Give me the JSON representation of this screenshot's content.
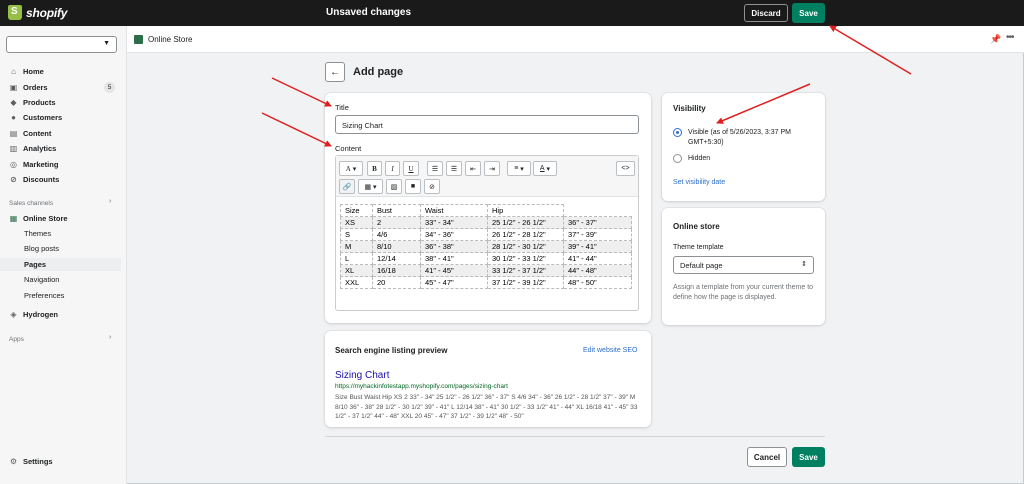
{
  "topbar": {
    "brand": "shopify",
    "status": "Unsaved changes",
    "discard_label": "Discard",
    "save_label": "Save"
  },
  "sidebar": {
    "store_selector_value": "",
    "items": [
      {
        "label": "Home",
        "icon": "home-icon"
      },
      {
        "label": "Orders",
        "icon": "orders-icon",
        "badge": "5"
      },
      {
        "label": "Products",
        "icon": "tag-icon"
      },
      {
        "label": "Customers",
        "icon": "person-icon"
      },
      {
        "label": "Content",
        "icon": "content-icon"
      },
      {
        "label": "Analytics",
        "icon": "chart-icon"
      },
      {
        "label": "Marketing",
        "icon": "target-icon"
      },
      {
        "label": "Discounts",
        "icon": "discount-icon"
      }
    ],
    "sales_channels_label": "Sales channels",
    "online_store_label": "Online Store",
    "online_store_subitems": [
      "Themes",
      "Blog posts",
      "Pages",
      "Navigation",
      "Preferences"
    ],
    "hydrogen_label": "Hydrogen",
    "apps_label": "Apps",
    "settings_label": "Settings"
  },
  "subheader": {
    "title": "Online Store"
  },
  "page": {
    "title": "Add page"
  },
  "form": {
    "title_label": "Title",
    "title_value": "Sizing Chart",
    "content_label": "Content"
  },
  "editor": {
    "toolbar_glyphs": {
      "font": "A",
      "bold": "B",
      "italic": "I",
      "underline": "U",
      "align": "≡",
      "color": "A",
      "html": "<>"
    },
    "table": {
      "header": [
        "Size",
        "Bust",
        "Waist",
        "Hip",
        ""
      ],
      "rows": [
        [
          "XS",
          "2",
          "33\" - 34\"",
          "25 1/2\" - 26 1/2\"",
          "36\" - 37\""
        ],
        [
          "S",
          "4/6",
          "34\" - 36\"",
          "26 1/2\" - 28 1/2\"",
          "37\" - 39\""
        ],
        [
          "M",
          "8/10",
          "36\" - 38\"",
          "28 1/2\" - 30 1/2\"",
          "39\" - 41\""
        ],
        [
          "L",
          "12/14",
          "38\" - 41\"",
          "30 1/2\" - 33 1/2\"",
          "41\" - 44\""
        ],
        [
          "XL",
          "16/18",
          "41\" - 45\"",
          "33 1/2\" - 37 1/2\"",
          "44\" - 48\""
        ],
        [
          "XXL",
          "20",
          "45\" - 47\"",
          "37 1/2\" - 39 1/2\"",
          "48\" - 50\""
        ]
      ]
    }
  },
  "seo": {
    "heading": "Search engine listing preview",
    "edit_link": "Edit website SEO",
    "preview_title": "Sizing Chart",
    "preview_url": "https://myhackinfotestapp.myshopify.com/pages/sizing-chart",
    "preview_description": "Size Bust Waist Hip XS 2 33\" - 34\" 25 1/2\" - 26 1/2\" 36\" - 37\" S 4/6 34\" - 36\" 26 1/2\" - 28 1/2\" 37\" - 39\" M 8/10 36\" - 38\" 28 1/2\" - 30 1/2\" 39\" - 41\" L 12/14 38\" - 41\" 30 1/2\" - 33 1/2\" 41\" - 44\" XL 16/18 41\" - 45\" 33 1/2\" - 37 1/2\" 44\" - 48\" XXL 20 45\" - 47\" 37 1/2\" - 39 1/2\" 48\" - 50\""
  },
  "visibility": {
    "heading": "Visibility",
    "visible_label": "Visible (as of 5/26/2023, 3:37 PM GMT+5:30)",
    "hidden_label": "Hidden",
    "set_date_link": "Set visibility date",
    "selected": "visible"
  },
  "online_store_card": {
    "heading": "Online store",
    "template_label": "Theme template",
    "template_value": "Default page",
    "help_text": "Assign a template from your current theme to define how the page is displayed."
  },
  "footer": {
    "cancel_label": "Cancel",
    "save_label": "Save"
  },
  "colors": {
    "primary": "#008060",
    "link": "#2c6ecb",
    "topbar": "#1a1a1a",
    "annotation_arrow": "#e02020"
  }
}
